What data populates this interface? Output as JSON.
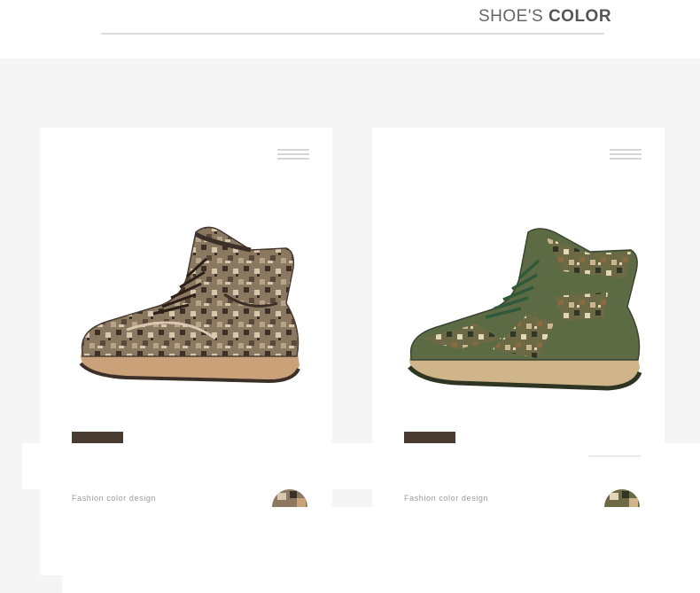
{
  "header": {
    "title_light": "SHOE'S",
    "title_bold": "COLOR"
  },
  "products": [
    {
      "colorway": "brown-digital-camo",
      "caption": "Fashion color design",
      "icon": "menu-icon",
      "colors": {
        "base": "#7a6a55",
        "dark": "#3b2f28",
        "mid": "#a08a70",
        "light": "#d8c8b0",
        "sole": "#c9a27a"
      }
    },
    {
      "colorway": "green-digital-camo",
      "caption": "Fashion color design",
      "icon": "menu-icon",
      "colors": {
        "base": "#5d6b45",
        "dark": "#2e3522",
        "mid": "#8a7f55",
        "light": "#e2d6b8",
        "sole": "#d0b48a"
      }
    }
  ],
  "colors": {
    "background_band": "#f5f5f6",
    "card": "#ffffff",
    "label_bar": "#4a3b32",
    "rule": "#dcdcdc",
    "title": "#555555"
  }
}
